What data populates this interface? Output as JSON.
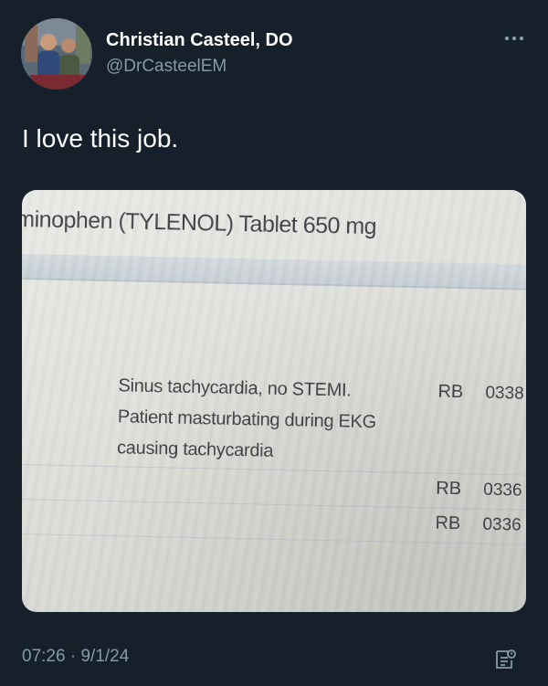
{
  "author": {
    "name": "Christian Casteel, DO",
    "handle": "@DrCasteelEM"
  },
  "tweet": {
    "text": "I love this job.",
    "time": "07:26",
    "date": "9/1/24"
  },
  "photo": {
    "medication_line": "minophen (TYLENOL) Tablet 650 mg",
    "note_lines": [
      "Sinus tachycardia, no STEMI.",
      "Patient masturbating during EKG",
      "causing tachycardia"
    ],
    "rows": [
      {
        "initials": "RB",
        "code": "0338"
      },
      {
        "initials": "RB",
        "code": "0336"
      },
      {
        "initials": "RB",
        "code": "0336"
      }
    ]
  },
  "icons": {
    "more": "more-horizontal-icon",
    "analytics": "analytics-icon"
  },
  "colors": {
    "background": "#15202b",
    "secondary_text": "#8899a6",
    "primary_text": "#ffffff"
  }
}
